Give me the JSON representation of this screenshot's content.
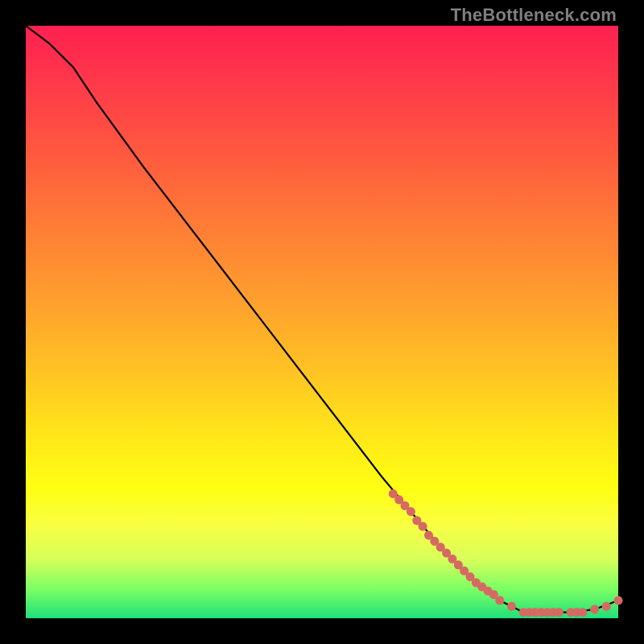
{
  "attribution": "TheBottleneck.com",
  "icon_color": "#d66a63",
  "chart_data": {
    "type": "line",
    "title": "",
    "xlabel": "",
    "ylabel": "",
    "xlim": [
      0,
      100
    ],
    "ylim": [
      0,
      100
    ],
    "grid": false,
    "legend": false,
    "curve": [
      {
        "x": 0,
        "y": 100
      },
      {
        "x": 4,
        "y": 97
      },
      {
        "x": 8,
        "y": 93
      },
      {
        "x": 12,
        "y": 87
      },
      {
        "x": 20,
        "y": 76
      },
      {
        "x": 30,
        "y": 63
      },
      {
        "x": 40,
        "y": 50
      },
      {
        "x": 50,
        "y": 37
      },
      {
        "x": 60,
        "y": 24
      },
      {
        "x": 65,
        "y": 18
      },
      {
        "x": 70,
        "y": 12
      },
      {
        "x": 75,
        "y": 7
      },
      {
        "x": 80,
        "y": 3
      },
      {
        "x": 84,
        "y": 1
      },
      {
        "x": 88,
        "y": 1
      },
      {
        "x": 92,
        "y": 1
      },
      {
        "x": 96,
        "y": 1.5
      },
      {
        "x": 100,
        "y": 3
      }
    ],
    "markers": [
      {
        "x": 62,
        "y": 21
      },
      {
        "x": 63,
        "y": 20
      },
      {
        "x": 64,
        "y": 19
      },
      {
        "x": 65,
        "y": 18
      },
      {
        "x": 66,
        "y": 16.5
      },
      {
        "x": 67,
        "y": 15.5
      },
      {
        "x": 68,
        "y": 14
      },
      {
        "x": 69,
        "y": 13
      },
      {
        "x": 70,
        "y": 12
      },
      {
        "x": 71,
        "y": 11
      },
      {
        "x": 72,
        "y": 10
      },
      {
        "x": 73,
        "y": 9
      },
      {
        "x": 74,
        "y": 8
      },
      {
        "x": 75,
        "y": 7
      },
      {
        "x": 76,
        "y": 6
      },
      {
        "x": 77,
        "y": 5.3
      },
      {
        "x": 78,
        "y": 4.6
      },
      {
        "x": 79,
        "y": 4
      },
      {
        "x": 80,
        "y": 3
      },
      {
        "x": 82,
        "y": 2
      },
      {
        "x": 84,
        "y": 1
      },
      {
        "x": 85,
        "y": 1
      },
      {
        "x": 86,
        "y": 1
      },
      {
        "x": 87,
        "y": 1
      },
      {
        "x": 88,
        "y": 1
      },
      {
        "x": 89,
        "y": 1
      },
      {
        "x": 90,
        "y": 1
      },
      {
        "x": 92,
        "y": 1
      },
      {
        "x": 93,
        "y": 1
      },
      {
        "x": 94,
        "y": 1
      },
      {
        "x": 96,
        "y": 1.5
      },
      {
        "x": 98,
        "y": 2
      },
      {
        "x": 100,
        "y": 3
      }
    ]
  }
}
